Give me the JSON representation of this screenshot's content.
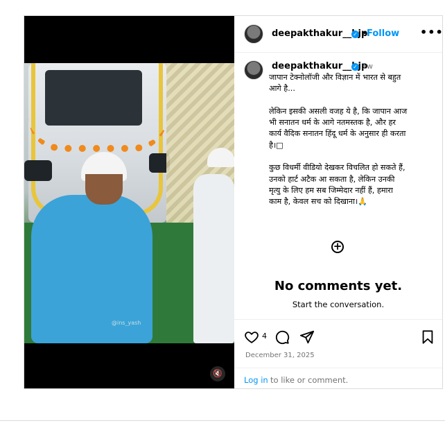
{
  "post": {
    "username": "deepakthakur__bjp",
    "follow_label": "Follow",
    "separator": "•",
    "more_label": "•••",
    "time_ago": "1w",
    "caption": "जापान टेक्नोलॉजी और विज्ञान में भारत से बहुत\nआगे है...\n\nलेकिन इसकी असली वजह ये है, कि जापान आज\nभी सनातन धर्म के आगे नतमस्तक है, और हर\nकार्य वैदिक सनातन हिंदू धर्म के अनुसार ही करता\nहै।□\n\nकुछ विधर्मी वीडियो देखकर विचलित हो सकते हैं,\nउनको हार्ट अटैक आ सकता है, लेकिन उनकी\nमृत्यु के लिए हम सब जिम्मेदार नहीं हैं, हमारा\nकाम है, केवल सच को दिखाना।🙏",
    "no_comments": "No comments yet.",
    "start_conversation": "Start the conversation.",
    "like_count": "4",
    "date": "December 31, 2025",
    "login_link": "Log in",
    "login_suffix": "to like or comment.",
    "video_watermark": "@ins_yash",
    "icons": {
      "verified": "verified-badge-icon",
      "add": "add-comment-icon",
      "like": "heart-icon",
      "comment": "comment-bubble-icon",
      "share": "paper-plane-icon",
      "save": "bookmark-icon",
      "mute": "speaker-muted-icon"
    },
    "colors": {
      "link": "#0095f6",
      "muted_text": "#737373",
      "border": "#dbdbdb"
    }
  }
}
